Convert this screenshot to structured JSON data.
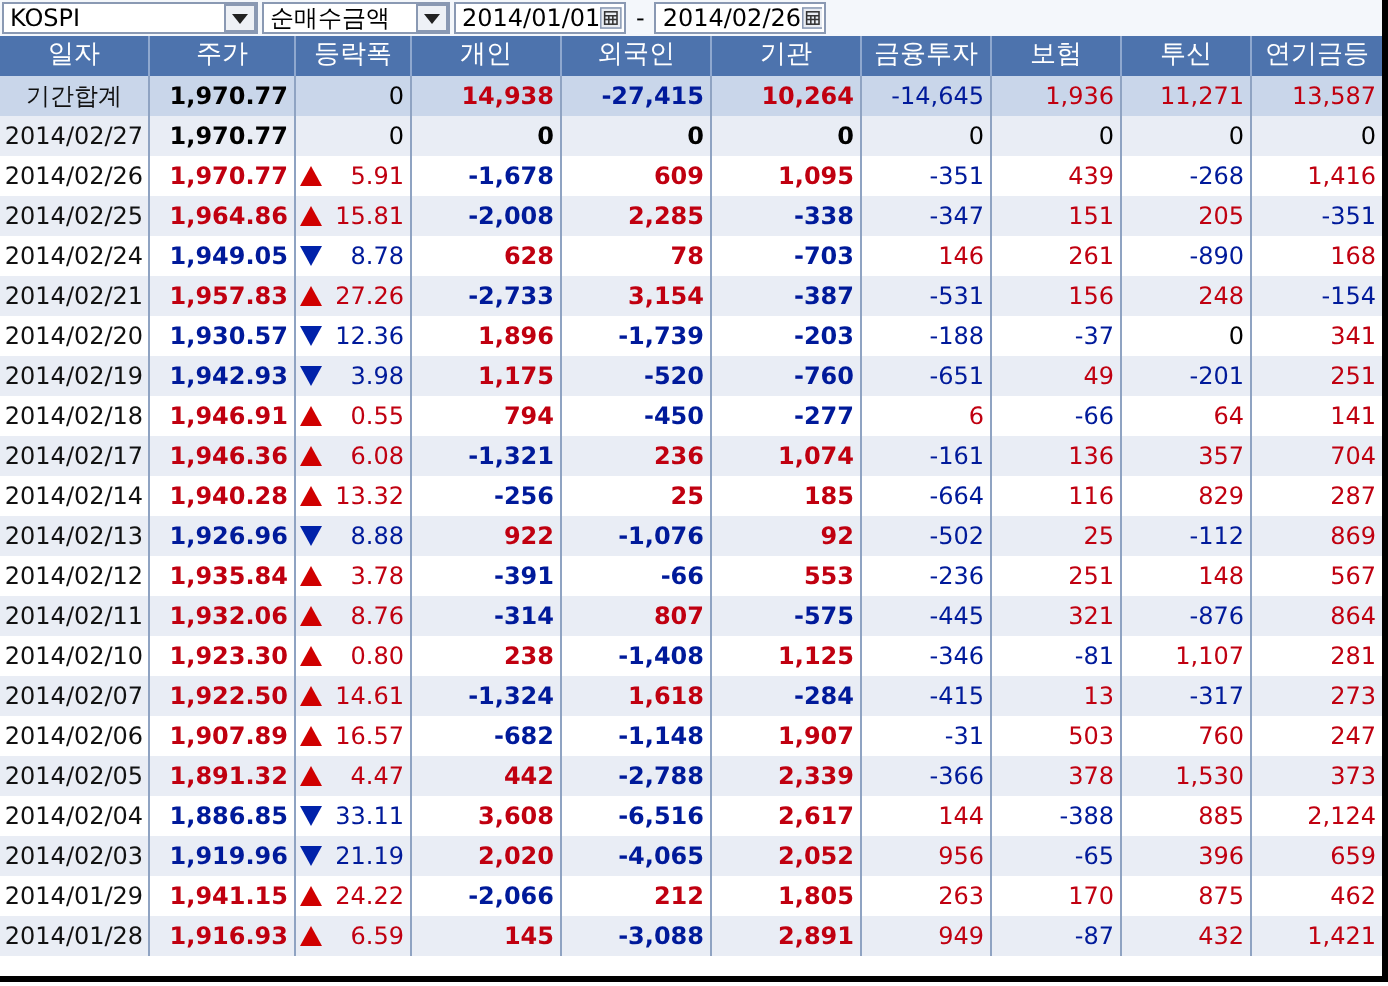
{
  "toolbar": {
    "market": "KOSPI",
    "metric": "순매수금액",
    "start_date": "2014/01/01",
    "separator": "-",
    "end_date": "2014/02/26"
  },
  "table": {
    "columns": [
      "일자",
      "주가",
      "등락폭",
      "개인",
      "외국인",
      "기관",
      "금융투자",
      "보험",
      "투신",
      "연기금등"
    ],
    "rows": [
      {
        "kind": "summary",
        "date": "기간합계",
        "price": "1,970.77",
        "rising": false,
        "falling": false,
        "change": "0",
        "values": [
          {
            "text": "14,938",
            "color": "#c00010"
          },
          {
            "text": "-27,415",
            "color": "#001a9a"
          },
          {
            "text": "10,264",
            "color": "#c00010"
          },
          {
            "text": "-14,645",
            "color": "#001a9a"
          },
          {
            "text": "1,936",
            "color": "#c00010"
          },
          {
            "text": "11,271",
            "color": "#c00010"
          },
          {
            "text": "13,587",
            "color": "#c00010"
          }
        ]
      },
      {
        "kind": "day",
        "date": "2014/02/27",
        "price": "1,970.77",
        "rising": false,
        "falling": false,
        "change": "0",
        "values": [
          {
            "text": "0",
            "color": "#000000"
          },
          {
            "text": "0",
            "color": "#000000"
          },
          {
            "text": "0",
            "color": "#000000"
          },
          {
            "text": "0",
            "color": "#000000"
          },
          {
            "text": "0",
            "color": "#000000"
          },
          {
            "text": "0",
            "color": "#000000"
          },
          {
            "text": "0",
            "color": "#000000"
          }
        ]
      },
      {
        "kind": "day",
        "date": "2014/02/26",
        "price": "1,970.77",
        "rising": true,
        "falling": false,
        "change": "5.91",
        "values": [
          {
            "text": "-1,678",
            "color": "#001a9a"
          },
          {
            "text": "609",
            "color": "#c00010"
          },
          {
            "text": "1,095",
            "color": "#c00010"
          },
          {
            "text": "-351",
            "color": "#001a9a"
          },
          {
            "text": "439",
            "color": "#c00010"
          },
          {
            "text": "-268",
            "color": "#001a9a"
          },
          {
            "text": "1,416",
            "color": "#c00010"
          }
        ]
      },
      {
        "kind": "day",
        "date": "2014/02/25",
        "price": "1,964.86",
        "rising": true,
        "falling": false,
        "change": "15.81",
        "values": [
          {
            "text": "-2,008",
            "color": "#001a9a"
          },
          {
            "text": "2,285",
            "color": "#c00010"
          },
          {
            "text": "-338",
            "color": "#001a9a"
          },
          {
            "text": "-347",
            "color": "#001a9a"
          },
          {
            "text": "151",
            "color": "#c00010"
          },
          {
            "text": "205",
            "color": "#c00010"
          },
          {
            "text": "-351",
            "color": "#001a9a"
          }
        ]
      },
      {
        "kind": "day",
        "date": "2014/02/24",
        "price": "1,949.05",
        "rising": false,
        "falling": true,
        "change": "8.78",
        "values": [
          {
            "text": "628",
            "color": "#c00010"
          },
          {
            "text": "78",
            "color": "#c00010"
          },
          {
            "text": "-703",
            "color": "#001a9a"
          },
          {
            "text": "146",
            "color": "#c00010"
          },
          {
            "text": "261",
            "color": "#c00010"
          },
          {
            "text": "-890",
            "color": "#001a9a"
          },
          {
            "text": "168",
            "color": "#c00010"
          }
        ]
      },
      {
        "kind": "day",
        "date": "2014/02/21",
        "price": "1,957.83",
        "rising": true,
        "falling": false,
        "change": "27.26",
        "values": [
          {
            "text": "-2,733",
            "color": "#001a9a"
          },
          {
            "text": "3,154",
            "color": "#c00010"
          },
          {
            "text": "-387",
            "color": "#001a9a"
          },
          {
            "text": "-531",
            "color": "#001a9a"
          },
          {
            "text": "156",
            "color": "#c00010"
          },
          {
            "text": "248",
            "color": "#c00010"
          },
          {
            "text": "-154",
            "color": "#001a9a"
          }
        ]
      },
      {
        "kind": "day",
        "date": "2014/02/20",
        "price": "1,930.57",
        "rising": false,
        "falling": true,
        "change": "12.36",
        "values": [
          {
            "text": "1,896",
            "color": "#c00010"
          },
          {
            "text": "-1,739",
            "color": "#001a9a"
          },
          {
            "text": "-203",
            "color": "#001a9a"
          },
          {
            "text": "-188",
            "color": "#001a9a"
          },
          {
            "text": "-37",
            "color": "#001a9a"
          },
          {
            "text": "0",
            "color": "#000000"
          },
          {
            "text": "341",
            "color": "#c00010"
          }
        ]
      },
      {
        "kind": "day",
        "date": "2014/02/19",
        "price": "1,942.93",
        "rising": false,
        "falling": true,
        "change": "3.98",
        "values": [
          {
            "text": "1,175",
            "color": "#c00010"
          },
          {
            "text": "-520",
            "color": "#001a9a"
          },
          {
            "text": "-760",
            "color": "#001a9a"
          },
          {
            "text": "-651",
            "color": "#001a9a"
          },
          {
            "text": "49",
            "color": "#c00010"
          },
          {
            "text": "-201",
            "color": "#001a9a"
          },
          {
            "text": "251",
            "color": "#c00010"
          }
        ]
      },
      {
        "kind": "day",
        "date": "2014/02/18",
        "price": "1,946.91",
        "rising": true,
        "falling": false,
        "change": "0.55",
        "values": [
          {
            "text": "794",
            "color": "#c00010"
          },
          {
            "text": "-450",
            "color": "#001a9a"
          },
          {
            "text": "-277",
            "color": "#001a9a"
          },
          {
            "text": "6",
            "color": "#c00010"
          },
          {
            "text": "-66",
            "color": "#001a9a"
          },
          {
            "text": "64",
            "color": "#c00010"
          },
          {
            "text": "141",
            "color": "#c00010"
          }
        ]
      },
      {
        "kind": "day",
        "date": "2014/02/17",
        "price": "1,946.36",
        "rising": true,
        "falling": false,
        "change": "6.08",
        "values": [
          {
            "text": "-1,321",
            "color": "#001a9a"
          },
          {
            "text": "236",
            "color": "#c00010"
          },
          {
            "text": "1,074",
            "color": "#c00010"
          },
          {
            "text": "-161",
            "color": "#001a9a"
          },
          {
            "text": "136",
            "color": "#c00010"
          },
          {
            "text": "357",
            "color": "#c00010"
          },
          {
            "text": "704",
            "color": "#c00010"
          }
        ]
      },
      {
        "kind": "day",
        "date": "2014/02/14",
        "price": "1,940.28",
        "rising": true,
        "falling": false,
        "change": "13.32",
        "values": [
          {
            "text": "-256",
            "color": "#001a9a"
          },
          {
            "text": "25",
            "color": "#c00010"
          },
          {
            "text": "185",
            "color": "#c00010"
          },
          {
            "text": "-664",
            "color": "#001a9a"
          },
          {
            "text": "116",
            "color": "#c00010"
          },
          {
            "text": "829",
            "color": "#c00010"
          },
          {
            "text": "287",
            "color": "#c00010"
          }
        ]
      },
      {
        "kind": "day",
        "date": "2014/02/13",
        "price": "1,926.96",
        "rising": false,
        "falling": true,
        "change": "8.88",
        "values": [
          {
            "text": "922",
            "color": "#c00010"
          },
          {
            "text": "-1,076",
            "color": "#001a9a"
          },
          {
            "text": "92",
            "color": "#c00010"
          },
          {
            "text": "-502",
            "color": "#001a9a"
          },
          {
            "text": "25",
            "color": "#c00010"
          },
          {
            "text": "-112",
            "color": "#001a9a"
          },
          {
            "text": "869",
            "color": "#c00010"
          }
        ]
      },
      {
        "kind": "day",
        "date": "2014/02/12",
        "price": "1,935.84",
        "rising": true,
        "falling": false,
        "change": "3.78",
        "values": [
          {
            "text": "-391",
            "color": "#001a9a"
          },
          {
            "text": "-66",
            "color": "#001a9a"
          },
          {
            "text": "553",
            "color": "#c00010"
          },
          {
            "text": "-236",
            "color": "#001a9a"
          },
          {
            "text": "251",
            "color": "#c00010"
          },
          {
            "text": "148",
            "color": "#c00010"
          },
          {
            "text": "567",
            "color": "#c00010"
          }
        ]
      },
      {
        "kind": "day",
        "date": "2014/02/11",
        "price": "1,932.06",
        "rising": true,
        "falling": false,
        "change": "8.76",
        "values": [
          {
            "text": "-314",
            "color": "#001a9a"
          },
          {
            "text": "807",
            "color": "#c00010"
          },
          {
            "text": "-575",
            "color": "#001a9a"
          },
          {
            "text": "-445",
            "color": "#001a9a"
          },
          {
            "text": "321",
            "color": "#c00010"
          },
          {
            "text": "-876",
            "color": "#001a9a"
          },
          {
            "text": "864",
            "color": "#c00010"
          }
        ]
      },
      {
        "kind": "day",
        "date": "2014/02/10",
        "price": "1,923.30",
        "rising": true,
        "falling": false,
        "change": "0.80",
        "values": [
          {
            "text": "238",
            "color": "#c00010"
          },
          {
            "text": "-1,408",
            "color": "#001a9a"
          },
          {
            "text": "1,125",
            "color": "#c00010"
          },
          {
            "text": "-346",
            "color": "#001a9a"
          },
          {
            "text": "-81",
            "color": "#001a9a"
          },
          {
            "text": "1,107",
            "color": "#c00010"
          },
          {
            "text": "281",
            "color": "#c00010"
          }
        ]
      },
      {
        "kind": "day",
        "date": "2014/02/07",
        "price": "1,922.50",
        "rising": true,
        "falling": false,
        "change": "14.61",
        "values": [
          {
            "text": "-1,324",
            "color": "#001a9a"
          },
          {
            "text": "1,618",
            "color": "#c00010"
          },
          {
            "text": "-284",
            "color": "#001a9a"
          },
          {
            "text": "-415",
            "color": "#001a9a"
          },
          {
            "text": "13",
            "color": "#c00010"
          },
          {
            "text": "-317",
            "color": "#001a9a"
          },
          {
            "text": "273",
            "color": "#c00010"
          }
        ]
      },
      {
        "kind": "day",
        "date": "2014/02/06",
        "price": "1,907.89",
        "rising": true,
        "falling": false,
        "change": "16.57",
        "values": [
          {
            "text": "-682",
            "color": "#001a9a"
          },
          {
            "text": "-1,148",
            "color": "#001a9a"
          },
          {
            "text": "1,907",
            "color": "#c00010"
          },
          {
            "text": "-31",
            "color": "#001a9a"
          },
          {
            "text": "503",
            "color": "#c00010"
          },
          {
            "text": "760",
            "color": "#c00010"
          },
          {
            "text": "247",
            "color": "#c00010"
          }
        ]
      },
      {
        "kind": "day",
        "date": "2014/02/05",
        "price": "1,891.32",
        "rising": true,
        "falling": false,
        "change": "4.47",
        "values": [
          {
            "text": "442",
            "color": "#c00010"
          },
          {
            "text": "-2,788",
            "color": "#001a9a"
          },
          {
            "text": "2,339",
            "color": "#c00010"
          },
          {
            "text": "-366",
            "color": "#001a9a"
          },
          {
            "text": "378",
            "color": "#c00010"
          },
          {
            "text": "1,530",
            "color": "#c00010"
          },
          {
            "text": "373",
            "color": "#c00010"
          }
        ]
      },
      {
        "kind": "day",
        "date": "2014/02/04",
        "price": "1,886.85",
        "rising": false,
        "falling": true,
        "change": "33.11",
        "values": [
          {
            "text": "3,608",
            "color": "#c00010"
          },
          {
            "text": "-6,516",
            "color": "#001a9a"
          },
          {
            "text": "2,617",
            "color": "#c00010"
          },
          {
            "text": "144",
            "color": "#c00010"
          },
          {
            "text": "-388",
            "color": "#001a9a"
          },
          {
            "text": "885",
            "color": "#c00010"
          },
          {
            "text": "2,124",
            "color": "#c00010"
          }
        ]
      },
      {
        "kind": "day",
        "date": "2014/02/03",
        "price": "1,919.96",
        "rising": false,
        "falling": true,
        "change": "21.19",
        "values": [
          {
            "text": "2,020",
            "color": "#c00010"
          },
          {
            "text": "-4,065",
            "color": "#001a9a"
          },
          {
            "text": "2,052",
            "color": "#c00010"
          },
          {
            "text": "956",
            "color": "#c00010"
          },
          {
            "text": "-65",
            "color": "#001a9a"
          },
          {
            "text": "396",
            "color": "#c00010"
          },
          {
            "text": "659",
            "color": "#c00010"
          }
        ]
      },
      {
        "kind": "day",
        "date": "2014/01/29",
        "price": "1,941.15",
        "rising": true,
        "falling": false,
        "change": "24.22",
        "values": [
          {
            "text": "-2,066",
            "color": "#001a9a"
          },
          {
            "text": "212",
            "color": "#c00010"
          },
          {
            "text": "1,805",
            "color": "#c00010"
          },
          {
            "text": "263",
            "color": "#c00010"
          },
          {
            "text": "170",
            "color": "#c00010"
          },
          {
            "text": "875",
            "color": "#c00010"
          },
          {
            "text": "462",
            "color": "#c00010"
          }
        ]
      },
      {
        "kind": "day",
        "date": "2014/01/28",
        "price": "1,916.93",
        "rising": true,
        "falling": false,
        "change": "6.59",
        "values": [
          {
            "text": "145",
            "color": "#c00010"
          },
          {
            "text": "-3,088",
            "color": "#001a9a"
          },
          {
            "text": "2,891",
            "color": "#c00010"
          },
          {
            "text": "949",
            "color": "#c00010"
          },
          {
            "text": "-87",
            "color": "#001a9a"
          },
          {
            "text": "432",
            "color": "#c00010"
          },
          {
            "text": "1,421",
            "color": "#c00010"
          }
        ]
      }
    ]
  }
}
